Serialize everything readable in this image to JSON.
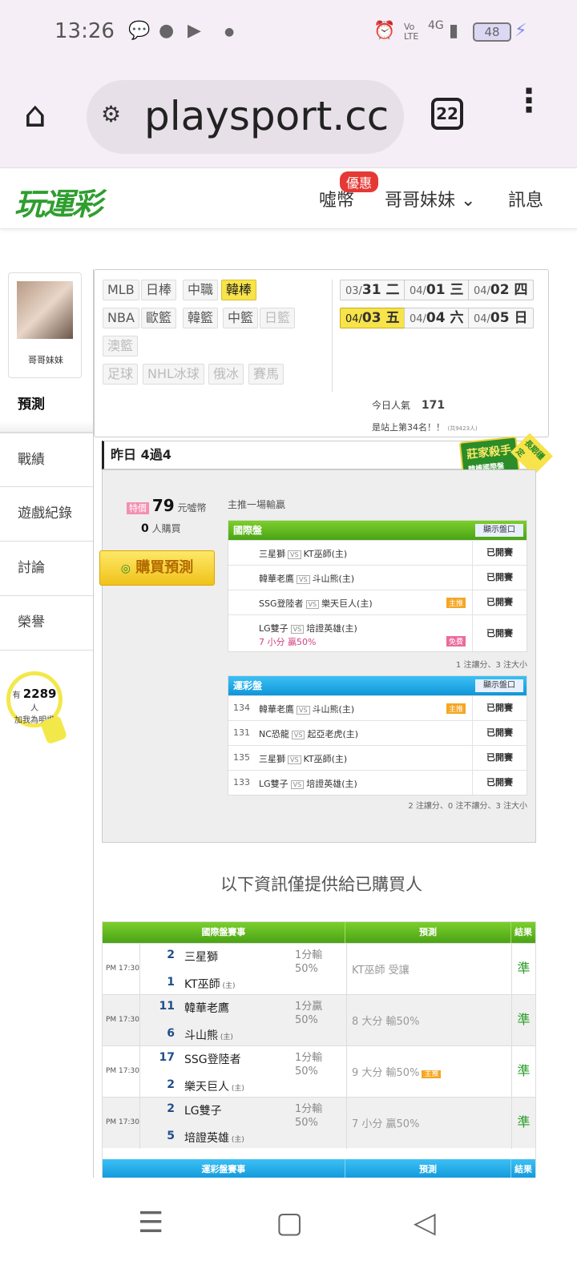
{
  "status_bar": {
    "time": "13:26",
    "battery": "48",
    "network": "4G"
  },
  "browser": {
    "url": "playsport.cc",
    "tab_count": "22"
  },
  "site": {
    "logo": "玩運彩",
    "nav": [
      {
        "label": "噓幣",
        "badge": "優惠"
      },
      {
        "label": "哥哥妹妹 ⌄"
      },
      {
        "label": "訊息"
      }
    ]
  },
  "sidebar": {
    "username": "哥哥妹妹",
    "items": [
      "預測",
      "戰績",
      "遊戲紀錄",
      "討論",
      "榮譽"
    ],
    "fans_prefix": "有",
    "fans_count": "2289",
    "fans_suffix": "人",
    "fans_caption": "加我為明燈"
  },
  "categories": [
    {
      "label": "MLB",
      "state": "normal"
    },
    {
      "label": "日棒",
      "state": "normal"
    },
    {
      "label": "中職",
      "state": "normal"
    },
    {
      "label": "韓棒",
      "state": "selected"
    },
    {
      "label": "NBA",
      "state": "normal"
    },
    {
      "label": "歐籃",
      "state": "normal"
    },
    {
      "label": "韓籃",
      "state": "normal"
    },
    {
      "label": "中籃",
      "state": "normal"
    },
    {
      "label": "日籃",
      "state": "disabled"
    },
    {
      "label": "澳籃",
      "state": "disabled"
    },
    {
      "label": "足球",
      "state": "disabled"
    },
    {
      "label": "NHL冰球",
      "state": "disabled"
    },
    {
      "label": "俄冰",
      "state": "disabled"
    },
    {
      "label": "賽馬",
      "state": "disabled"
    }
  ],
  "dates": [
    {
      "md": "03/",
      "day": "31",
      "wd": "二",
      "selected": false
    },
    {
      "md": "04/",
      "day": "01",
      "wd": "三",
      "selected": false
    },
    {
      "md": "04/",
      "day": "02",
      "wd": "四",
      "selected": false
    },
    {
      "md": "04/",
      "day": "03",
      "wd": "五",
      "selected": true
    },
    {
      "md": "04/",
      "day": "04",
      "wd": "六",
      "selected": false
    },
    {
      "md": "04/",
      "day": "05",
      "wd": "日",
      "selected": false
    }
  ],
  "popularity": {
    "label": "今日人氣",
    "value": "171",
    "rank_text": "是站上第34名！！",
    "rank_small": "(共9423人)"
  },
  "ribbon": {
    "title": "莊家殺手",
    "sub": "韓棒國際盤",
    "corner": "長期穩定"
  },
  "yesterday": "昨日 4過4",
  "purchase": {
    "tag": "特價",
    "price": "79",
    "unit": "元噓幣",
    "buyers": "0",
    "buyers_unit": "人購買",
    "button": "購買預測",
    "main_push": "主推一場輸贏"
  },
  "intl_table": {
    "title": "國際盤",
    "show_btn": "顯示盤口",
    "rows": [
      {
        "home": "三星獅",
        "away": "KT巫師(主)",
        "status": "已開賽",
        "flag": "",
        "extra": ""
      },
      {
        "home": "韓華老鷹",
        "away": "斗山熊(主)",
        "status": "已開賽",
        "flag": "",
        "extra": ""
      },
      {
        "home": "SSG登陸者",
        "away": "樂天巨人(主)",
        "status": "已開賽",
        "flag": "主推",
        "extra": ""
      },
      {
        "home": "LG雙子",
        "away": "培證英雄(主)",
        "status": "已開賽",
        "flag": "免費",
        "extra": "7 小分 贏50%"
      }
    ],
    "footer": "1 注讓分、3 注大小"
  },
  "lottery_table": {
    "title": "運彩盤",
    "show_btn": "顯示盤口",
    "rows": [
      {
        "num": "134",
        "home": "韓華老鷹",
        "away": "斗山熊(主)",
        "status": "已開賽",
        "flag": "主推"
      },
      {
        "num": "131",
        "home": "NC恐龍",
        "away": "起亞老虎(主)",
        "status": "已開賽",
        "flag": ""
      },
      {
        "num": "135",
        "home": "三星獅",
        "away": "KT巫師(主)",
        "status": "已開賽",
        "flag": ""
      },
      {
        "num": "133",
        "home": "LG雙子",
        "away": "培證英雄(主)",
        "status": "已開賽",
        "flag": ""
      }
    ],
    "footer": "2 注讓分、0 注不讓分、3 注大小"
  },
  "info_text": "以下資訊僅提供給已購買人",
  "results_table": {
    "headers": [
      "國際盤賽事",
      "預測",
      "結果"
    ],
    "rows": [
      {
        "time": "PM 17:30",
        "n1": "2",
        "team1": "三星獅",
        "n2": "1",
        "team2": "KT巫師",
        "line": "1分輸",
        "pct": "50%",
        "pred": "KT巫師",
        "pred_note": "受讓",
        "flag": "",
        "result": "準"
      },
      {
        "time": "PM 17:30",
        "n1": "11",
        "team1": "韓華老鷹",
        "n2": "6",
        "team2": "斗山熊",
        "line": "1分贏",
        "pct": "50%",
        "pred": "8 大分",
        "pred_note": "輸50%",
        "flag": "",
        "result": "準"
      },
      {
        "time": "PM 17:30",
        "n1": "17",
        "team1": "SSG登陸者",
        "n2": "2",
        "team2": "樂天巨人",
        "line": "1分輸",
        "pct": "50%",
        "pred": "9 大分",
        "pred_note": "輸50%",
        "flag": "主推",
        "result": "準"
      },
      {
        "time": "PM 17:30",
        "n1": "2",
        "team1": "LG雙子",
        "n2": "5",
        "team2": "培證英雄",
        "line": "1分輸",
        "pct": "50%",
        "pred": "7 小分",
        "pred_note": "贏50%",
        "flag": "",
        "result": "準"
      }
    ],
    "home_mark": "主",
    "second_headers": [
      "運彩盤賽事",
      "預測",
      "結果"
    ]
  },
  "colors": {
    "accent_yellow": "#f7e34a",
    "green_header": "#4aa315",
    "blue_header": "#0f96d8",
    "win_green": "#2a9d2a"
  }
}
